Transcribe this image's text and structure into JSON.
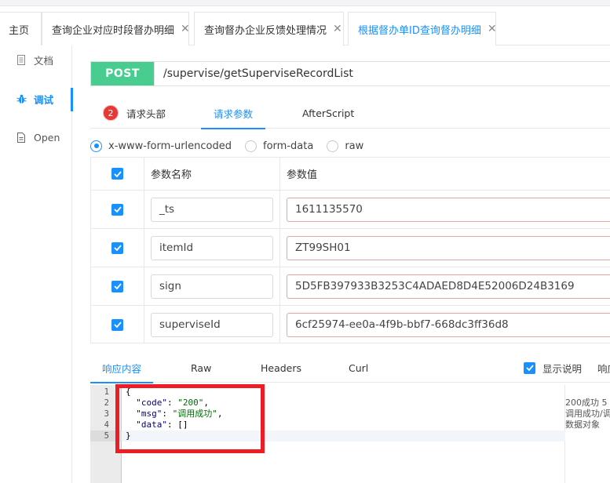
{
  "tabs": [
    {
      "label": "主页",
      "closable": false,
      "active": false
    },
    {
      "label": "查询企业对应时段督办明细",
      "closable": true,
      "active": false
    },
    {
      "label": "查询督办企业反馈处理情况",
      "closable": true,
      "active": false
    },
    {
      "label": "根据督办单ID查询督办明细",
      "closable": true,
      "active": true
    }
  ],
  "sidebar": {
    "items": [
      {
        "label": "文档",
        "icon": "document-icon",
        "active": false
      },
      {
        "label": "调试",
        "icon": "bug-icon",
        "active": true
      },
      {
        "label": "Open",
        "icon": "file-icon",
        "active": false
      }
    ]
  },
  "request": {
    "method": "POST",
    "url": "/supervise/getSuperviseRecordList",
    "method_color": "#49cc90"
  },
  "request_tabs": [
    {
      "label": "请求头部",
      "badge": "2",
      "active": false
    },
    {
      "label": "请求参数",
      "active": true
    },
    {
      "label": "AfterScript",
      "active": false
    }
  ],
  "body_types": [
    {
      "label": "x-www-form-urlencoded",
      "selected": true
    },
    {
      "label": "form-data",
      "selected": false
    },
    {
      "label": "raw",
      "selected": false
    }
  ],
  "params_table": {
    "headers": {
      "name": "参数名称",
      "value": "参数值"
    },
    "rows": [
      {
        "checked": true,
        "name": "_ts",
        "value": "1611135570"
      },
      {
        "checked": true,
        "name": "itemId",
        "value": "ZT99SH01"
      },
      {
        "checked": true,
        "name": "sign",
        "value": "5D5FB397933B3253C4ADAED8D4E52006D24B3169"
      },
      {
        "checked": true,
        "name": "superviseId",
        "value": "6cf25974-ee0a-4f9b-bbf7-668dc3ff36d8"
      }
    ]
  },
  "response_tabs": [
    {
      "label": "响应内容",
      "active": true
    },
    {
      "label": "Raw",
      "active": false
    },
    {
      "label": "Headers",
      "active": false
    },
    {
      "label": "Curl",
      "active": false
    }
  ],
  "show_description": {
    "label": "显示说明",
    "checked": true
  },
  "response_cut_label": "响应",
  "response_code": {
    "line_numbers": [
      "1",
      "2",
      "3",
      "4",
      "5"
    ],
    "open_brace": "{",
    "close_brace": "}",
    "code_key": "\"code\"",
    "code_value": "\"200\"",
    "msg_key": "\"msg\"",
    "msg_value": "\"调用成功\"",
    "data_key": "\"data\"",
    "data_value": "[]"
  },
  "response_descriptions": [
    "200成功 5",
    "调用成功/调",
    "数据对象"
  ],
  "accent_color": "#1890ff",
  "highlight_color": "#ee1c25"
}
